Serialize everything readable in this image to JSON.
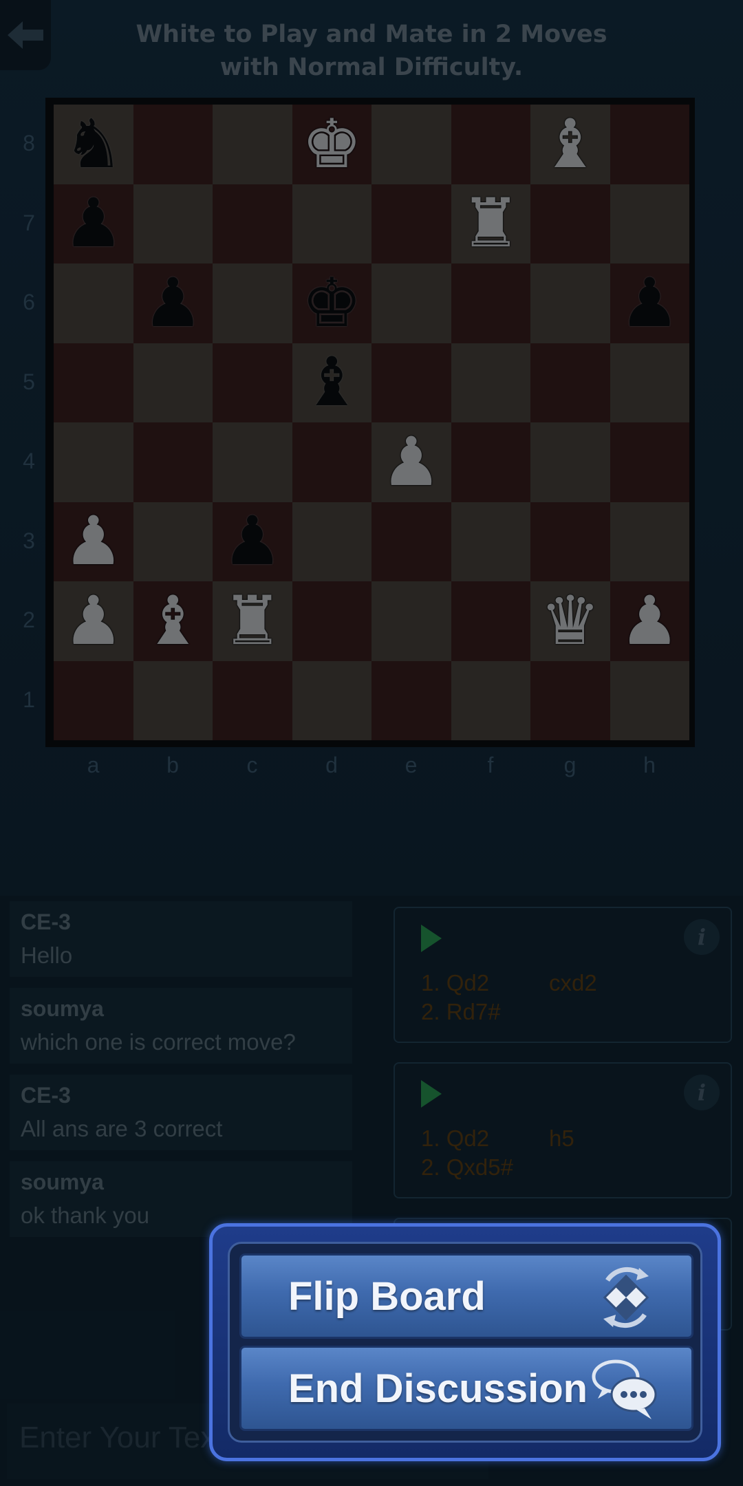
{
  "header": {
    "title_line1": "White to Play and Mate in 2 Moves",
    "title_line2": "with Normal Difficulty."
  },
  "board": {
    "ranks": [
      "8",
      "7",
      "6",
      "5",
      "4",
      "3",
      "2",
      "1"
    ],
    "files": [
      "a",
      "b",
      "c",
      "d",
      "e",
      "f",
      "g",
      "h"
    ],
    "pieces": {
      "a8": "bN",
      "d8": "wK",
      "g8": "wB",
      "a7": "bP",
      "f7": "wR",
      "b6": "bP",
      "d6": "bK",
      "h6": "bP",
      "d5": "bB",
      "e4": "wP",
      "a3": "wP",
      "c3": "bP",
      "a2": "wP",
      "b2": "wB",
      "c2": "wR",
      "g2": "wQ",
      "h2": "wP"
    }
  },
  "chat": {
    "messages": [
      {
        "user": "CE-3",
        "text": "Hello"
      },
      {
        "user": "soumya",
        "text": "which one is correct move?"
      },
      {
        "user": "CE-3",
        "text": "All ans are 3 correct"
      },
      {
        "user": "soumya",
        "text": "ok thank you"
      }
    ],
    "input_placeholder": "Enter Your Text"
  },
  "solutions": [
    {
      "info_label": "i",
      "moves": [
        {
          "num": "1. Qd2",
          "reply": "cxd2"
        },
        {
          "num": "2. Rd7#",
          "reply": ""
        }
      ]
    },
    {
      "info_label": "i",
      "moves": [
        {
          "num": "1. Qd2",
          "reply": "h5"
        },
        {
          "num": "2. Qxd5#",
          "reply": ""
        }
      ]
    }
  ],
  "popup": {
    "flip_label": "Flip Board",
    "end_label": "End Discussion",
    "flip_icon": "flip-board-icon",
    "end_icon": "chat-bubbles-icon"
  },
  "colors": {
    "accent": "#4b73e0",
    "play": "#1f7a3c",
    "move_text": "#4a2e08"
  }
}
